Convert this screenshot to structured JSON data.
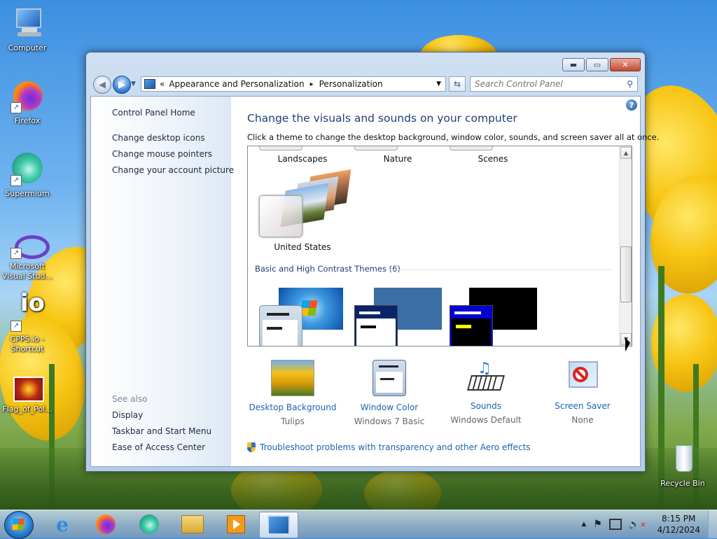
{
  "desktop": {
    "icons": [
      {
        "label": "Computer"
      },
      {
        "label": "Firefox"
      },
      {
        "label": "Supermium"
      },
      {
        "label": "Microsoft Visual Stud..."
      },
      {
        "label": "CPPS.io - Shortcut"
      },
      {
        "label": "Flag_of_Pol..."
      },
      {
        "label": "Recycle Bin"
      }
    ]
  },
  "window": {
    "caption_buttons": {
      "minimize": "▬",
      "maximize": "▭",
      "close": "✕"
    },
    "address": {
      "prefix": "«",
      "crumb1": "Appearance and Personalization",
      "sep": "▸",
      "crumb2": "Personalization"
    },
    "search_placeholder": "Search Control Panel",
    "left_links": [
      "Control Panel Home",
      "Change desktop icons",
      "Change mouse pointers",
      "Change your account picture"
    ],
    "see_also": {
      "title": "See also",
      "links": [
        "Display",
        "Taskbar and Start Menu",
        "Ease of Access Center"
      ]
    },
    "main": {
      "heading": "Change the visuals and sounds on your computer",
      "description": "Click a theme to change the desktop background, window color, sounds, and screen saver all at once.",
      "themes_row1": [
        "Landscapes",
        "Nature",
        "Scenes"
      ],
      "theme_selected": "United States",
      "group_header": "Basic and High Contrast Themes (6)"
    },
    "bottom": [
      {
        "label": "Desktop Background",
        "value": "Tulips"
      },
      {
        "label": "Window Color",
        "value": "Windows 7 Basic"
      },
      {
        "label": "Sounds",
        "value": "Windows Default"
      },
      {
        "label": "Screen Saver",
        "value": "None"
      }
    ],
    "troubleshoot": "Troubleshoot problems with transparency and other Aero effects"
  },
  "taskbar": {
    "clock": {
      "time": "8:15 PM",
      "date": "4/12/2024"
    }
  },
  "colors": {
    "link": "#1a63b3",
    "heading": "#1e3f73",
    "accent": "#2d7fd0"
  }
}
